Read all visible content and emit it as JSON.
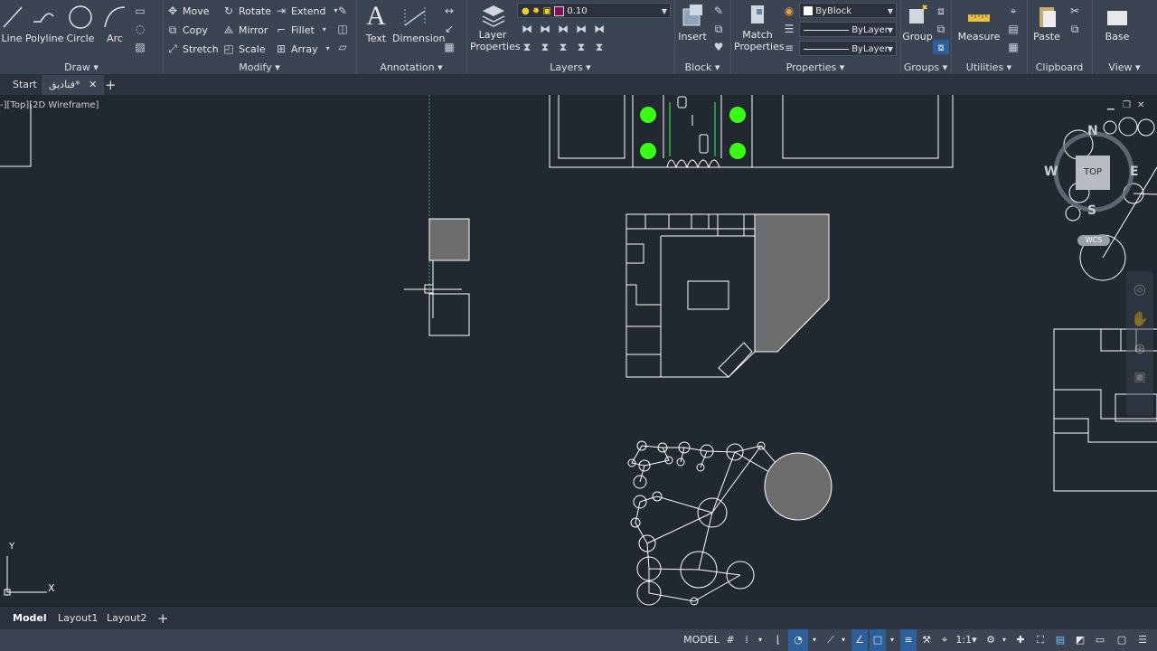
{
  "ribbon": {
    "draw": {
      "label": "Draw",
      "line": "Line",
      "polyline": "Polyline",
      "circle": "Circle",
      "arc": "Arc"
    },
    "modify": {
      "label": "Modify",
      "move": "Move",
      "rotate": "Rotate",
      "extend": "Extend",
      "copy": "Copy",
      "mirror": "Mirror",
      "fillet": "Fillet",
      "stretch": "Stretch",
      "scale": "Scale",
      "array": "Array"
    },
    "annotation": {
      "label": "Annotation",
      "text": "Text",
      "dimension": "Dimension"
    },
    "layers": {
      "label": "Layers",
      "layer_properties_line1": "Layer",
      "layer_properties_line2": "Properties",
      "current_layer": "0.10"
    },
    "block": {
      "label": "Block",
      "insert": "Insert"
    },
    "properties": {
      "label": "Properties",
      "match_line1": "Match",
      "match_line2": "Properties",
      "color": "ByBlock",
      "linetype": "ByLayer",
      "lineweight": "ByLayer"
    },
    "groups": {
      "label": "Groups",
      "group": "Group"
    },
    "utilities": {
      "label": "Utilities",
      "measure": "Measure"
    },
    "clipboard": {
      "label": "Clipboard",
      "paste": "Paste"
    },
    "view": {
      "label": "View",
      "base": "Base"
    }
  },
  "file_tabs": {
    "start": "Start",
    "drawing": "فناديق*"
  },
  "viewport": {
    "label": "-][Top][2D Wireframe]"
  },
  "viewcube": {
    "north": "N",
    "south": "S",
    "east": "E",
    "west": "W",
    "face": "TOP",
    "ucs": "WCS"
  },
  "ucs_axes": {
    "x": "X",
    "y": "Y"
  },
  "layout_tabs": {
    "model": "Model",
    "layout1": "Layout1",
    "layout2": "Layout2"
  },
  "status": {
    "space": "MODEL",
    "scale": "1:1"
  },
  "colors": {
    "background": "#212830",
    "ribbon": "#3b4453",
    "accent": "#4a90d9",
    "plant_green": "#39ff14"
  }
}
